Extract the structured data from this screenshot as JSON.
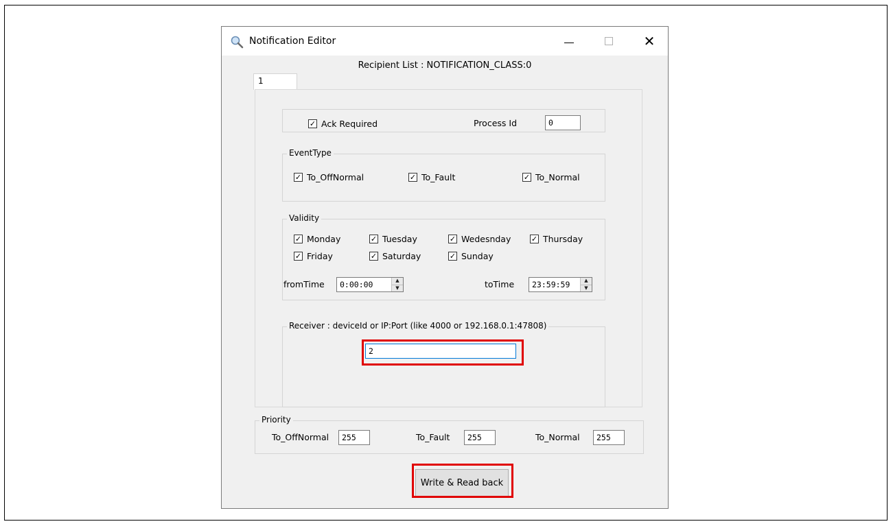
{
  "window": {
    "title": "Notification Editor",
    "minimize_icon": "minimize-icon",
    "maximize_icon": "maximize-icon",
    "close_icon": "close-icon"
  },
  "recipient_list_label": "Recipient List : NOTIFICATION_CLASS:0",
  "tabs": [
    {
      "label": "1"
    }
  ],
  "ack_required": {
    "label": "Ack Required",
    "checked": true
  },
  "process_id": {
    "label": "Process Id",
    "value": "0"
  },
  "event_type": {
    "caption": "EventType",
    "items": [
      {
        "label": "To_OffNormal",
        "checked": true
      },
      {
        "label": "To_Fault",
        "checked": true
      },
      {
        "label": "To_Normal",
        "checked": true
      }
    ]
  },
  "validity": {
    "caption": "Validity",
    "days": [
      {
        "label": "Monday",
        "checked": true
      },
      {
        "label": "Tuesday",
        "checked": true
      },
      {
        "label": "Wedesnday",
        "checked": true
      },
      {
        "label": "Thursday",
        "checked": true
      },
      {
        "label": "Friday",
        "checked": true
      },
      {
        "label": "Saturday",
        "checked": true
      },
      {
        "label": "Sunday",
        "checked": true
      }
    ],
    "from_label": "fromTime",
    "from_value": "0:00:00",
    "to_label": "toTime",
    "to_value": "23:59:59"
  },
  "receiver": {
    "caption": "Receiver :  deviceId or IP:Port (like 4000 or 192.168.0.1:47808)",
    "value": "2"
  },
  "priority": {
    "caption": "Priority",
    "items": [
      {
        "label": "To_OffNormal",
        "value": "255"
      },
      {
        "label": "To_Fault",
        "value": "255"
      },
      {
        "label": "To_Normal",
        "value": "255"
      }
    ]
  },
  "write_button": {
    "label": "Write & Read back"
  },
  "check_glyph": "✓",
  "highlight_color": "#e00000"
}
